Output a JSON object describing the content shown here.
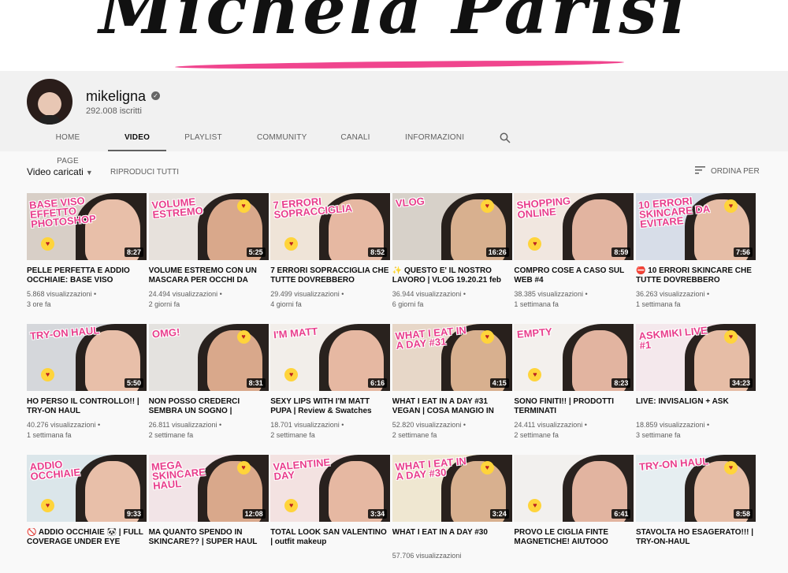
{
  "banner": {
    "title": "Michela Parisi"
  },
  "channel": {
    "name": "mikeligna",
    "subscribers": "292.008 iscritti"
  },
  "tabs": [
    {
      "label": "HOME PAGE"
    },
    {
      "label": "VIDEO"
    },
    {
      "label": "PLAYLIST"
    },
    {
      "label": "COMMUNITY"
    },
    {
      "label": "CANALI"
    },
    {
      "label": "INFORMAZIONI"
    }
  ],
  "toolbar": {
    "uploaded": "Video caricati",
    "play_all": "RIPRODUCI TUTTI",
    "sort": "ORDINA PER"
  },
  "videos": [
    {
      "title": "PELLE PERFETTA E ADDIO OCCHIAIE: BASE VISO",
      "views": "5.868 visualizzazioni",
      "age": "3 ore fa",
      "duration": "8:27",
      "thumb_text": "BASE VISO EFFETTO PHOTOSHOP"
    },
    {
      "title": "VOLUME ESTREMO CON UN MASCARA PER OCCHI DA",
      "views": "24.494 visualizzazioni",
      "age": "2 giorni fa",
      "duration": "5:25",
      "thumb_text": "VOLUME ESTREMO"
    },
    {
      "title": "7 ERRORI SOPRACCIGLIA CHE TUTTE DOVREBBERO",
      "views": "29.499 visualizzazioni",
      "age": "4 giorni fa",
      "duration": "8:52",
      "thumb_text": "7 ERRORI SOPRACCIGLIA"
    },
    {
      "title": "✨ QUESTO E' IL NOSTRO LAVORO | VLOG 19.20.21 feb",
      "views": "36.944 visualizzazioni",
      "age": "6 giorni fa",
      "duration": "16:26",
      "thumb_text": "VLOG"
    },
    {
      "title": "COMPRO COSE A CASO SUL WEB #4",
      "views": "38.385 visualizzazioni",
      "age": "1 settimana fa",
      "duration": "8:59",
      "thumb_text": "SHOPPING ONLINE"
    },
    {
      "title": "⛔ 10 ERRORI SKINCARE CHE TUTTE DOVREBBERO",
      "views": "36.263 visualizzazioni",
      "age": "1 settimana fa",
      "duration": "7:56",
      "thumb_text": "10 ERRORI SKINCARE DA EVITARE"
    },
    {
      "title": "HO PERSO IL CONTROLLO!! | TRY-ON HAUL",
      "views": "40.276 visualizzazioni",
      "age": "1 settimana fa",
      "duration": "5:50",
      "thumb_text": "TRY-ON HAUL"
    },
    {
      "title": "NON POSSO CREDERCI SEMBRA UN SOGNO |",
      "views": "26.811 visualizzazioni",
      "age": "2 settimane fa",
      "duration": "8:31",
      "thumb_text": "OMG!"
    },
    {
      "title": "SEXY LIPS WITH I'M MATT PUPA | Review & Swatches",
      "views": "18.701 visualizzazioni",
      "age": "2 settimane fa",
      "duration": "6:16",
      "thumb_text": "I'M MATT"
    },
    {
      "title": "WHAT I EAT IN A DAY #31 VEGAN | COSA MANGIO IN",
      "views": "52.820 visualizzazioni",
      "age": "2 settimane fa",
      "duration": "4:15",
      "thumb_text": "WHAT I EAT IN A DAY #31"
    },
    {
      "title": "SONO FINITI!! | PRODOTTI TERMINATI",
      "views": "24.411 visualizzazioni",
      "age": "2 settimane fa",
      "duration": "8:23",
      "thumb_text": "EMPTY"
    },
    {
      "title": "LIVE: INVISALIGN + ASK",
      "views": "18.859 visualizzazioni",
      "age": "3 settimane fa",
      "duration": "34:23",
      "thumb_text": "ASKMIKI LIVE #1"
    },
    {
      "title": "🚫 ADDIO OCCHIAIE 🐼 | FULL COVERAGE UNDER EYE",
      "views": "",
      "age": "",
      "duration": "9:33",
      "thumb_text": "ADDIO OCCHIAIE"
    },
    {
      "title": "MA QUANTO SPENDO IN SKINCARE?? | SUPER HAUL",
      "views": "",
      "age": "",
      "duration": "12:08",
      "thumb_text": "MEGA SKINCARE HAUL"
    },
    {
      "title": "TOTAL LOOK SAN VALENTINO | outfit makeup",
      "views": "",
      "age": "",
      "duration": "3:34",
      "thumb_text": "VALENTINE DAY"
    },
    {
      "title": "WHAT I EAT IN A DAY #30",
      "views": "57.706 visualizzazioni",
      "age": "",
      "duration": "3:24",
      "thumb_text": "WHAT I EAT IN A DAY #30"
    },
    {
      "title": "PROVO LE CIGLIA FINTE MAGNETICHE! AIUTOOO",
      "views": "",
      "age": "",
      "duration": "6:41",
      "thumb_text": ""
    },
    {
      "title": "STAVOLTA HO ESAGERATO!!! | TRY-ON-HAUL",
      "views": "",
      "age": "",
      "duration": "8:58",
      "thumb_text": "TRY-ON HAUL"
    }
  ],
  "colors": {
    "accent_pink": "#f0458e",
    "header_bg": "#f1f1f1"
  }
}
